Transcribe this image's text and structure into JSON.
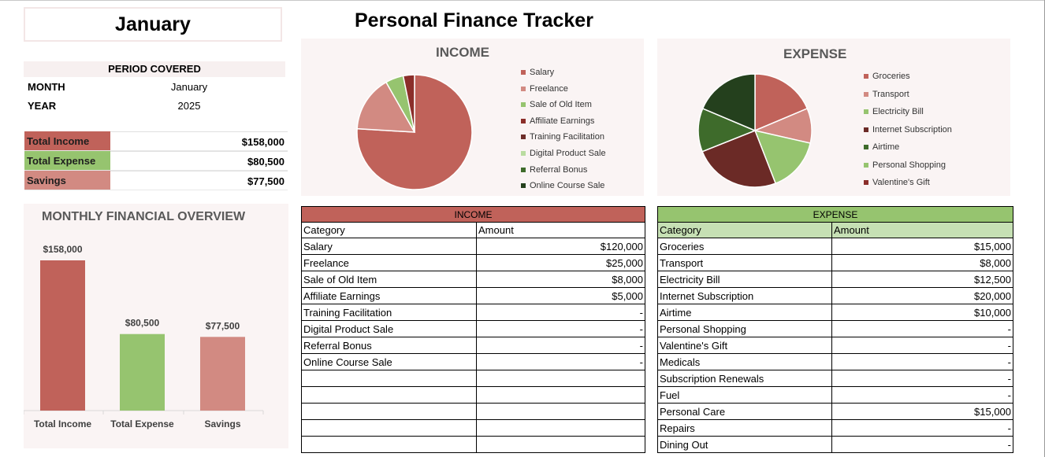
{
  "month_box": "January",
  "title": "Personal Finance Tracker",
  "period": {
    "heading": "PERIOD COVERED",
    "rows": [
      {
        "label": "MONTH",
        "value": "January"
      },
      {
        "label": "YEAR",
        "value": "2025"
      }
    ]
  },
  "totals": [
    {
      "label": "Total Income",
      "value": "$158,000",
      "color": "#c0625a"
    },
    {
      "label": "Total Expense",
      "value": "$80,500",
      "color": "#96c46f"
    },
    {
      "label": "Savings",
      "value": "$77,500",
      "color": "#d28a82"
    }
  ],
  "overview": {
    "title": "MONTHLY FINANCIAL OVERVIEW",
    "chart_data": {
      "type": "bar",
      "categories": [
        "Total Income",
        "Total Expense",
        "Savings"
      ],
      "values": [
        158000,
        80500,
        77500
      ],
      "data_labels": [
        "$158,000",
        "$80,500",
        "$77,500"
      ],
      "colors": [
        "#c0625a",
        "#96c46f",
        "#d28a82"
      ]
    }
  },
  "income_pie": {
    "title": "INCOME",
    "chart_data": {
      "type": "pie",
      "categories": [
        "Salary",
        "Freelance",
        "Sale of Old Item",
        "Affiliate Earnings",
        "Training Facilitation",
        "Digital Product Sale",
        "Referral Bonus",
        "Online Course Sale"
      ],
      "values": [
        120000,
        25000,
        8000,
        5000,
        0,
        0,
        0,
        0
      ],
      "colors": [
        "#c0625a",
        "#d28a82",
        "#96c46f",
        "#8b2e2a",
        "#6d2e2a",
        "#b9dca0",
        "#3e6b2b",
        "#24401d"
      ]
    }
  },
  "expense_pie": {
    "title": "EXPENSE",
    "chart_data": {
      "type": "pie",
      "categories": [
        "Groceries",
        "Transport",
        "Electricity Bill",
        "Internet Subscription",
        "Airtime",
        "Personal Shopping",
        "Valentine's Gift"
      ],
      "values": [
        15000,
        8000,
        12500,
        20000,
        10000,
        0,
        0
      ],
      "slice_values": [
        15000,
        8000,
        12500,
        20000,
        10000,
        15000
      ],
      "colors": [
        "#c0625a",
        "#d28a82",
        "#96c46f",
        "#6b2a26",
        "#3e6b2b",
        "#96c46f",
        "#8b2e2a",
        "#24401d"
      ]
    }
  },
  "income_table": {
    "caption": "INCOME",
    "caption_color": "#c0625a",
    "headers": [
      "Category",
      "Amount"
    ],
    "rows": [
      [
        "Salary",
        "$120,000"
      ],
      [
        "Freelance",
        "$25,000"
      ],
      [
        "Sale of Old Item",
        "$8,000"
      ],
      [
        "Affiliate Earnings",
        "$5,000"
      ],
      [
        "Training Facilitation",
        "-"
      ],
      [
        "Digital Product Sale",
        "-"
      ],
      [
        "Referral Bonus",
        "-"
      ],
      [
        "Online Course Sale",
        "-"
      ],
      [
        "",
        ""
      ],
      [
        "",
        ""
      ],
      [
        "",
        ""
      ],
      [
        "",
        ""
      ],
      [
        "",
        ""
      ]
    ]
  },
  "expense_table": {
    "caption": "EXPENSE",
    "caption_color": "#96c46f",
    "header_color": "#c6e0b4",
    "headers": [
      "Category",
      "Amount"
    ],
    "rows": [
      [
        "Groceries",
        "$15,000"
      ],
      [
        "Transport",
        "$8,000"
      ],
      [
        "Electricity Bill",
        "$12,500"
      ],
      [
        "Internet Subscription",
        "$20,000"
      ],
      [
        "Airtime",
        "$10,000"
      ],
      [
        "Personal Shopping",
        "-"
      ],
      [
        "Valentine's Gift",
        "-"
      ],
      [
        "Medicals",
        "-"
      ],
      [
        "Subscription Renewals",
        "-"
      ],
      [
        "Fuel",
        "-"
      ],
      [
        "Personal Care",
        "$15,000"
      ],
      [
        "Repairs",
        "-"
      ],
      [
        "Dining Out",
        "-"
      ]
    ]
  }
}
